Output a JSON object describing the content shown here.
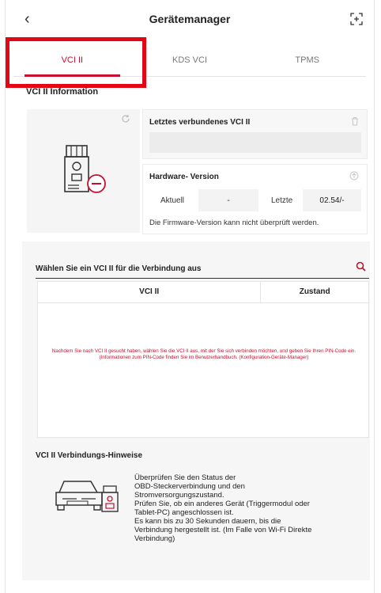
{
  "header": {
    "title": "Gerätemanager"
  },
  "tabs": [
    {
      "label": "VCI II",
      "active": true
    },
    {
      "label": "KDS VCI",
      "active": false
    },
    {
      "label": "TPMS",
      "active": false
    }
  ],
  "vci_info": {
    "section_title": "VCI II Information",
    "last_connected_title": "Letztes verbundenes VCI II",
    "last_connected_value": "",
    "hardware_title": "Hardware- Version",
    "current_label": "Aktuell",
    "current_value": "-",
    "latest_label": "Letzte",
    "latest_value": "02.54/-",
    "firmware_note": "Die Firmware-Version kann nicht überprüft werden."
  },
  "selection": {
    "title": "Wählen Sie ein VCI II für die Verbindung aus",
    "col_vci": "VCI II",
    "col_state": "Zustand",
    "hint": "Nachdem Sie nach VCI II gesucht haben, wählen Sie die VCI II aus, mit der Sie sich verbinden möchten, und geben Sie Ihren PIN-Code ein. (Informationen zum PIN-Code finden Sie im Benutzerhandbuch. (Konfiguration-Geräte-Manager)"
  },
  "tips": {
    "title": "VCI II Verbindungs-Hinweise",
    "body": "Überprüfen Sie den Status der\nOBD-Steckerverbindung und den\nStromversorgungszustand.\nPrüfen Sie, ob ein anderes Gerät (Triggermodul oder\nTablet-PC) angeschlossen ist.\nEs kann bis zu 30 Sekunden dauern, bis die\nVerbindung hergestellt ist. (Im Falle von Wi-Fi Direkte\nVerbindung)"
  },
  "colors": {
    "accent": "#c8102e",
    "highlight_box": "#e30613"
  }
}
